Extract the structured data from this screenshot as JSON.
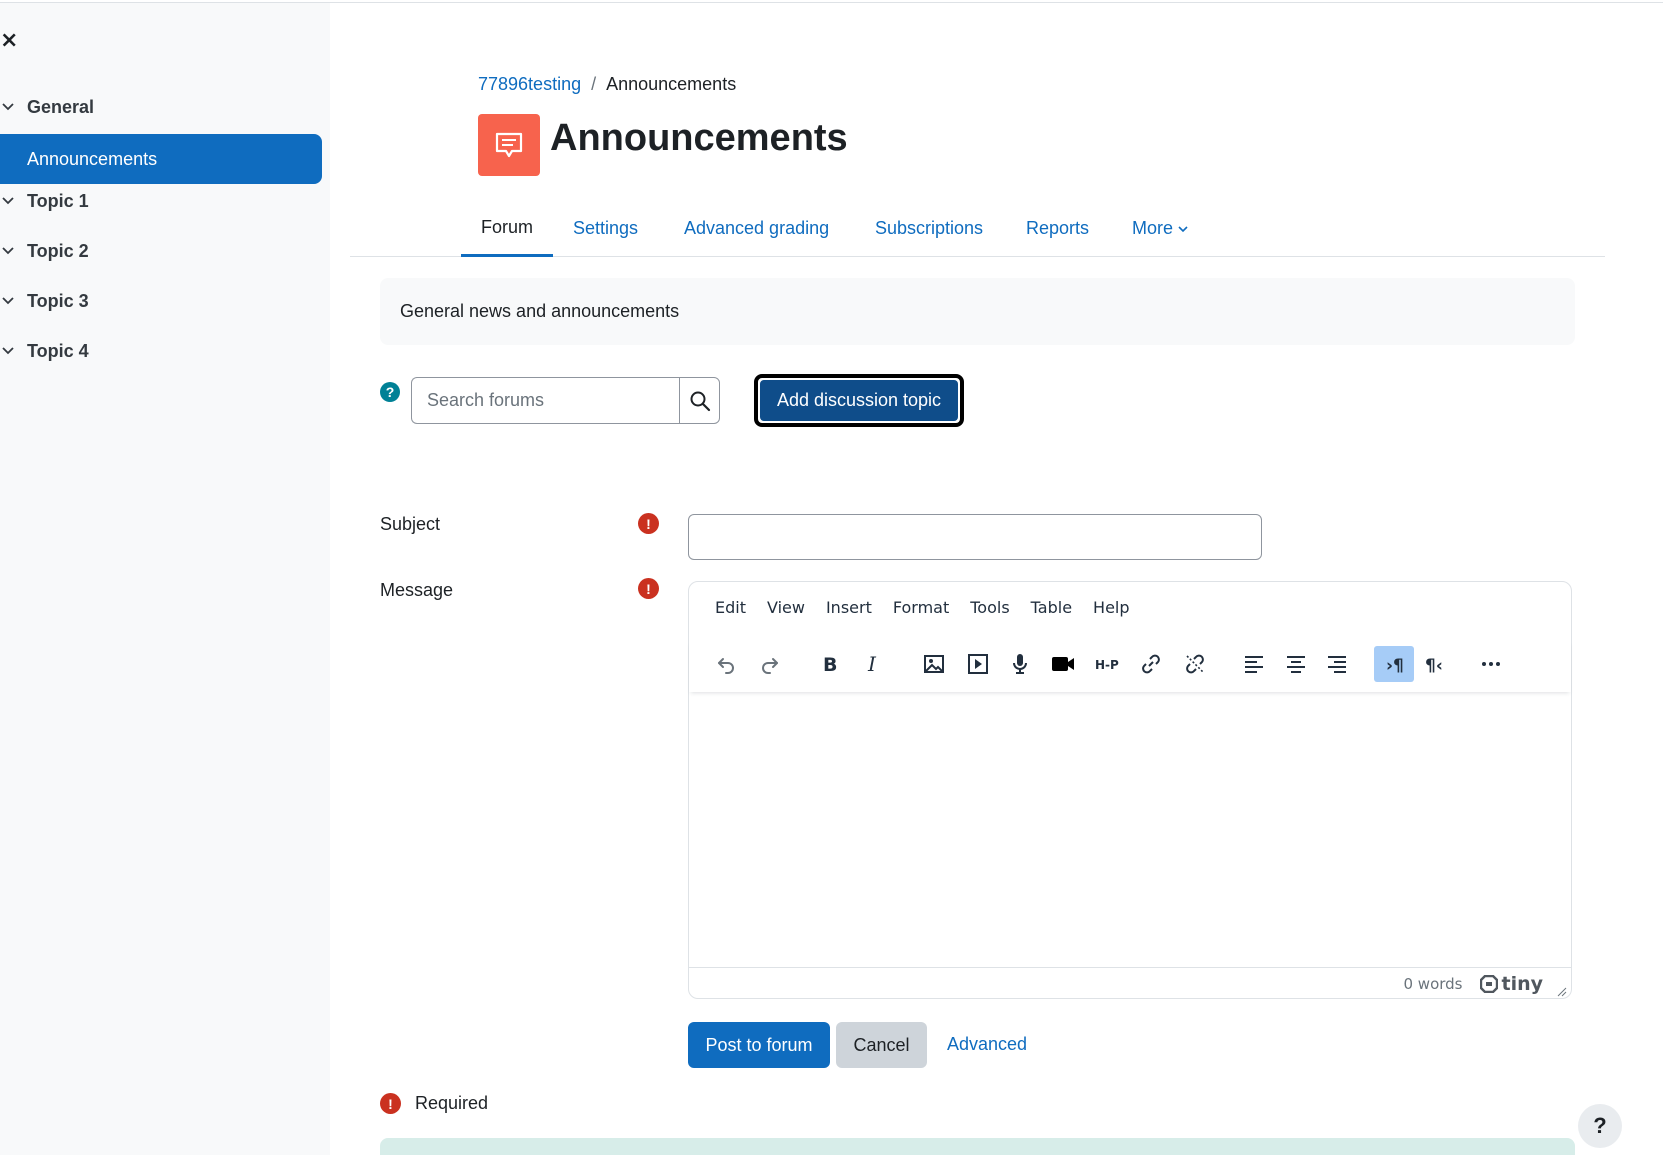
{
  "drawer": {
    "close_glyph": "×",
    "sections": [
      {
        "label": "General"
      },
      {
        "label": "Topic 1"
      },
      {
        "label": "Topic 2"
      },
      {
        "label": "Topic 3"
      },
      {
        "label": "Topic 4"
      }
    ],
    "active_item": "Announcements"
  },
  "breadcrumb": {
    "course": "77896testing",
    "separator": "/",
    "current": "Announcements"
  },
  "page_title": "Announcements",
  "tabs": [
    {
      "label": "Forum"
    },
    {
      "label": "Settings"
    },
    {
      "label": "Advanced grading"
    },
    {
      "label": "Subscriptions"
    },
    {
      "label": "Reports"
    },
    {
      "label": "More"
    }
  ],
  "intro_text": "General news and announcements",
  "search": {
    "placeholder": "Search forums",
    "help_glyph": "?"
  },
  "add_discussion_label": "Add discussion topic",
  "form": {
    "subject_label": "Subject",
    "message_label": "Message",
    "required_glyph": "!",
    "subject_value": ""
  },
  "editor": {
    "menus": [
      "Edit",
      "View",
      "Insert",
      "Format",
      "Tools",
      "Table",
      "Help"
    ],
    "toolbar_icons": [
      "undo-icon",
      "redo-icon",
      "bold-icon",
      "italic-icon",
      "image-icon",
      "media-icon",
      "record-audio-icon",
      "record-video-icon",
      "h5p-icon",
      "link-icon",
      "unlink-icon",
      "align-left-icon",
      "align-center-icon",
      "align-right-icon",
      "ltr-icon",
      "rtl-icon",
      "more-icon"
    ],
    "active_toolbar_icon": "ltr-icon",
    "word_count": "0 words",
    "brand": "tiny"
  },
  "buttons": {
    "post": "Post to forum",
    "cancel": "Cancel",
    "advanced": "Advanced"
  },
  "required_note": "Required",
  "help_fab_glyph": "?",
  "colors": {
    "primary": "#0f6cbf",
    "activity_icon_bg": "#f7634d",
    "required_red": "#ca3120",
    "help_teal": "#008196"
  }
}
